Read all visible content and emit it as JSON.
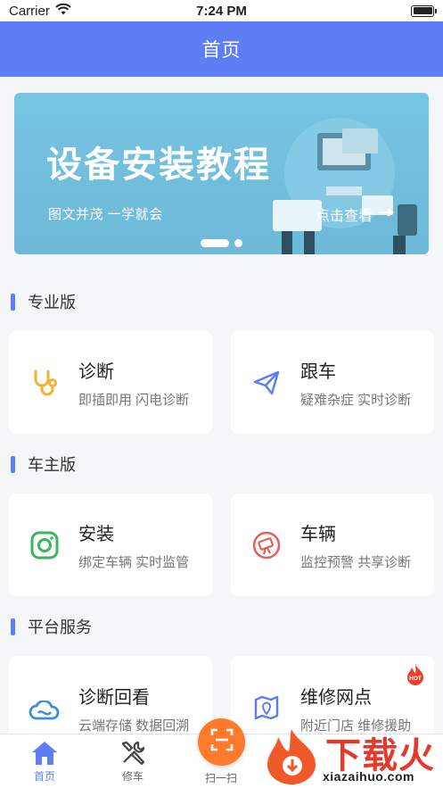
{
  "status": {
    "carrier": "Carrier",
    "time": "7:24 PM"
  },
  "navbar": {
    "title": "首页"
  },
  "banner": {
    "headline": "设备安装教程",
    "subtitle": "图文并茂   一学就会",
    "cta": "点击查看"
  },
  "sections": [
    {
      "title": "专业版",
      "cards": [
        {
          "title": "诊断",
          "desc": "即插即用 闪电诊断",
          "icon": "stethoscope-icon"
        },
        {
          "title": "跟车",
          "desc": "疑难杂症 实时诊断",
          "icon": "paper-plane-icon"
        }
      ]
    },
    {
      "title": "车主版",
      "cards": [
        {
          "title": "安装",
          "desc": "绑定车辆 实时监管",
          "icon": "camera-icon"
        },
        {
          "title": "车辆",
          "desc": "监控预警 共享诊断",
          "icon": "no-camera-icon"
        }
      ]
    },
    {
      "title": "平台服务",
      "cards": [
        {
          "title": "诊断回看",
          "desc": "云端存储 数据回溯",
          "icon": "cloud-icon"
        },
        {
          "title": "维修网点",
          "desc": "附近门店 维修援助",
          "icon": "map-pin-icon",
          "badge": "HOT"
        }
      ]
    }
  ],
  "tabbar": {
    "items": [
      {
        "label": "首页",
        "icon": "home-icon"
      },
      {
        "label": "修车",
        "icon": "tools-icon"
      },
      {
        "label": "扫一扫",
        "icon": "scan-icon"
      }
    ]
  },
  "watermark": {
    "text": "下载火",
    "url": "xiazaihuo.com"
  },
  "colors": {
    "primary": "#5f7ef6",
    "accent": "#ff7a2b",
    "banner": "#6db9d8"
  }
}
